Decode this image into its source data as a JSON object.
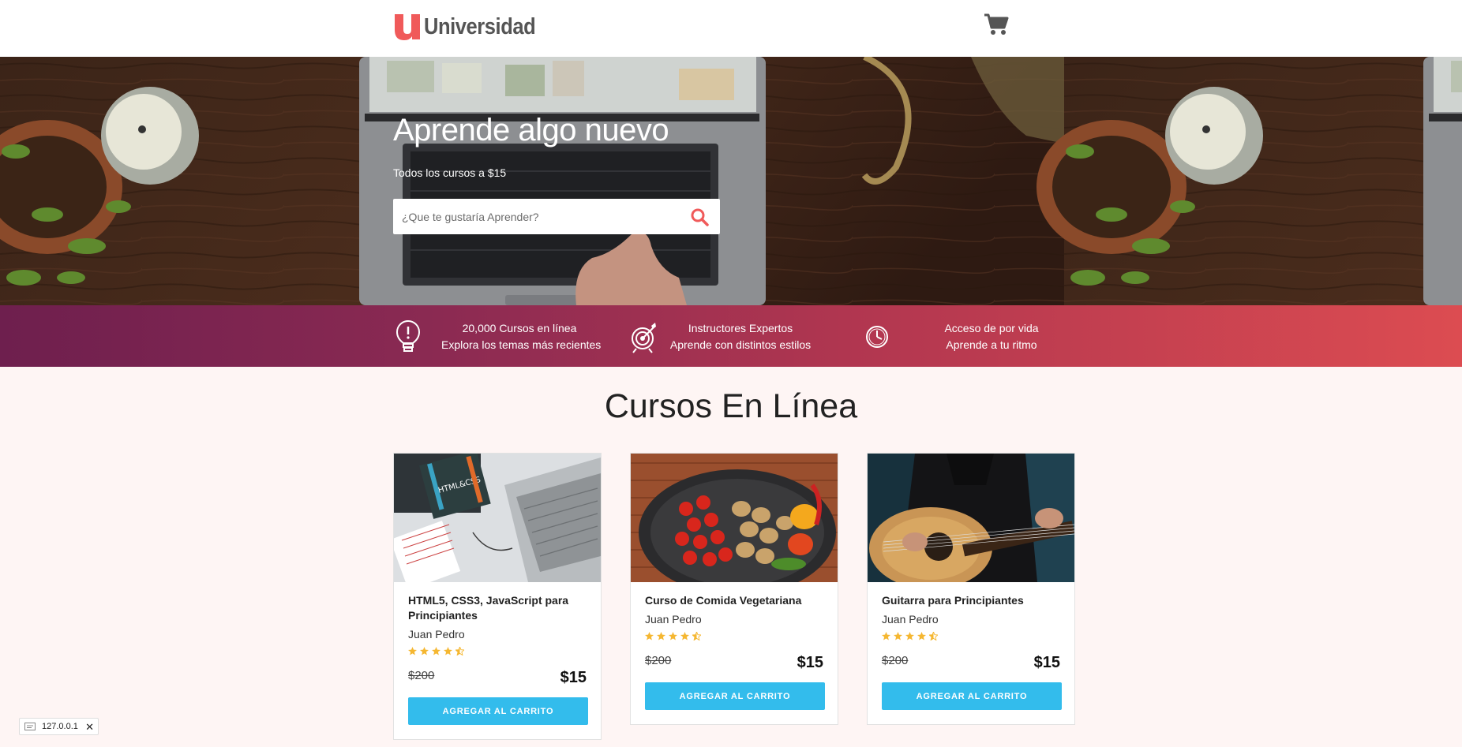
{
  "header": {
    "brand": "Universidad",
    "cart_icon": "shopping-cart-icon"
  },
  "hero": {
    "title": "Aprende algo nuevo",
    "subtitle": "Todos los cursos a $15",
    "search": {
      "placeholder": "¿Que te gustaría Aprender?",
      "value": "",
      "icon": "search-icon"
    }
  },
  "features": [
    {
      "icon": "lightbulb-icon",
      "line1": "20,000 Cursos en línea",
      "line2": "Explora los temas más recientes"
    },
    {
      "icon": "target-icon",
      "line1": "Instructores Expertos",
      "line2": "Aprende con distintos estilos"
    },
    {
      "icon": "clock-icon",
      "line1": "Acceso de por vida",
      "line2": "Aprende a tu ritmo"
    }
  ],
  "section": {
    "title": "Cursos En Línea"
  },
  "courses": [
    {
      "title": "HTML5, CSS3, JavaScript para Principiantes",
      "author": "Juan Pedro",
      "rating": 4.5,
      "old_price": "$200",
      "price": "$15",
      "button": "AGREGAR AL CARRITO",
      "image": "laptop-desk-image"
    },
    {
      "title": "Curso de Comida Vegetariana",
      "author": "Juan Pedro",
      "rating": 4.5,
      "old_price": "$200",
      "price": "$15",
      "button": "AGREGAR AL CARRITO",
      "image": "vegetables-pan-image"
    },
    {
      "title": "Guitarra para Principiantes",
      "author": "Juan Pedro",
      "rating": 4.5,
      "old_price": "$200",
      "price": "$15",
      "button": "AGREGAR AL CARRITO",
      "image": "guitar-player-image"
    }
  ],
  "status_chip": {
    "text": "127.0.0.1"
  },
  "colors": {
    "accent": "#33bcec",
    "brand_red": "#f05a5a",
    "star": "#f5b731",
    "gradient_start": "#6e1f4e",
    "gradient_end": "#dc4c51"
  }
}
